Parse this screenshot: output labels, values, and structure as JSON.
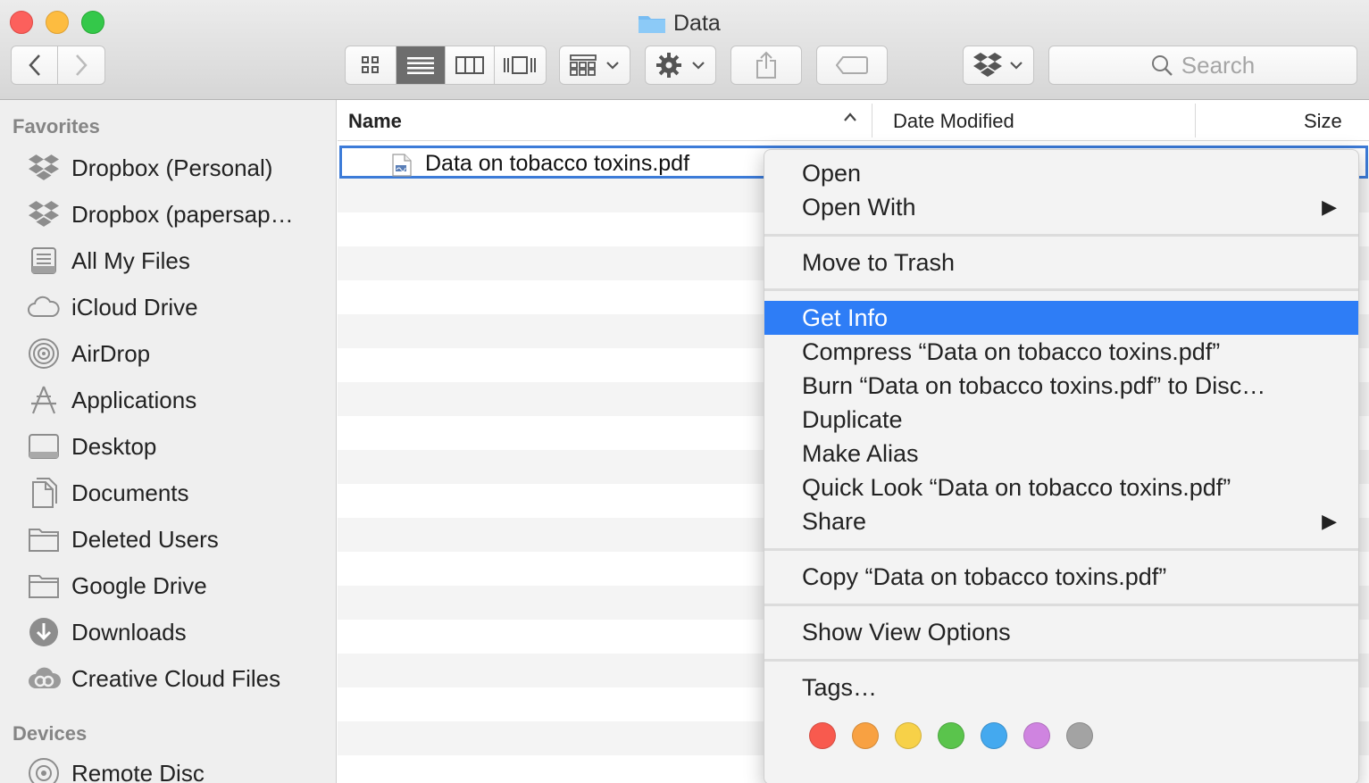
{
  "window": {
    "title": "Data"
  },
  "toolbar": {
    "search_placeholder": "Search"
  },
  "sidebar": {
    "favorites_heading": "Favorites",
    "devices_heading": "Devices",
    "items": [
      {
        "label": "Dropbox (Personal)",
        "icon": "dropbox-icon"
      },
      {
        "label": "Dropbox (papersap…",
        "icon": "dropbox-icon"
      },
      {
        "label": "All My Files",
        "icon": "all-files-icon"
      },
      {
        "label": "iCloud Drive",
        "icon": "cloud-icon"
      },
      {
        "label": "AirDrop",
        "icon": "airdrop-icon"
      },
      {
        "label": "Applications",
        "icon": "applications-icon"
      },
      {
        "label": "Desktop",
        "icon": "desktop-icon"
      },
      {
        "label": "Documents",
        "icon": "document-icon"
      },
      {
        "label": "Deleted Users",
        "icon": "folder-icon"
      },
      {
        "label": "Google Drive",
        "icon": "folder-icon"
      },
      {
        "label": "Downloads",
        "icon": "download-icon"
      },
      {
        "label": "Creative Cloud Files",
        "icon": "creative-cloud-icon"
      }
    ],
    "devices": [
      {
        "label": "Remote Disc",
        "icon": "disc-icon"
      }
    ]
  },
  "list": {
    "columns": {
      "name": "Name",
      "date_modified": "Date Modified",
      "size": "Size"
    },
    "sort_indicator": "^",
    "files": [
      {
        "name": "Data on tobacco toxins.pdf",
        "icon": "pdf-file-icon"
      }
    ]
  },
  "context_menu": {
    "items": [
      "Open",
      "Open With",
      "Move to Trash",
      "Get Info",
      "Compress “Data on tobacco toxins.pdf”",
      "Burn “Data on tobacco toxins.pdf” to Disc…",
      "Duplicate",
      "Make Alias",
      "Quick Look “Data on tobacco toxins.pdf”",
      "Share",
      "Copy “Data on tobacco toxins.pdf”",
      "Show View Options",
      "Tags…"
    ],
    "highlighted_item": "Get Info",
    "submenu_arrow": "▶",
    "tag_colors": [
      "#f85a4e",
      "#f8a142",
      "#f7d148",
      "#5ac44c",
      "#44a9ef",
      "#cf84e0",
      "#a3a3a3"
    ]
  }
}
